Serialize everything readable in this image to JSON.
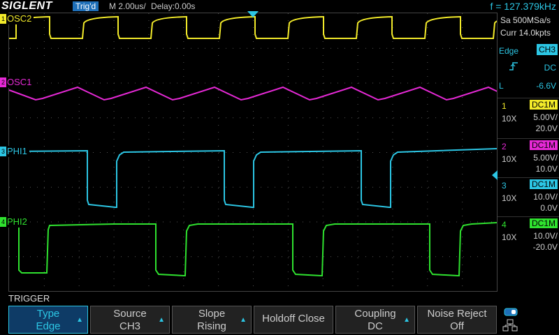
{
  "header": {
    "brand": "SIGLENT",
    "trigger_status": "Trig'd",
    "timebase": "M 2.00us/",
    "delay": "Delay:0.00s",
    "frequency": "f = 127.379kHz"
  },
  "channels": [
    {
      "num": "1",
      "label": "OSC2",
      "color": "#f2ea2a"
    },
    {
      "num": "2",
      "label": "OSC1",
      "color": "#e629d6"
    },
    {
      "num": "3",
      "label": "PHI1",
      "color": "#2cc6e4"
    },
    {
      "num": "4",
      "label": "PHI2",
      "color": "#2fe22f"
    }
  ],
  "acquisition": {
    "sample_rate": "Sa 500MSa/s",
    "memory": "Curr 14.0kpts"
  },
  "trigger_info": {
    "type": "Edge",
    "source": "CH3",
    "coupling": "DC",
    "level_label": "L",
    "level": "-6.6V"
  },
  "channel_settings": [
    {
      "num": "1",
      "coupling": "DC1M",
      "probe": "10X",
      "vdiv": "5.00V/",
      "offset": "20.0V",
      "color": "#f2ea2a"
    },
    {
      "num": "2",
      "coupling": "DC1M",
      "probe": "10X",
      "vdiv": "5.00V/",
      "offset": "10.0V",
      "color": "#e629d6"
    },
    {
      "num": "3",
      "coupling": "DC1M",
      "probe": "10X",
      "vdiv": "10.0V/",
      "offset": "0.0V",
      "color": "#2cc6e4"
    },
    {
      "num": "4",
      "coupling": "DC1M",
      "probe": "10X",
      "vdiv": "10.0V/",
      "offset": "-20.0V",
      "color": "#2fe22f"
    }
  ],
  "menu": {
    "title": "TRIGGER",
    "softkeys": [
      {
        "line1": "Type",
        "line2": "Edge"
      },
      {
        "line1": "Source",
        "line2": "CH3"
      },
      {
        "line1": "Slope",
        "line2": "Rising"
      },
      {
        "line1": "Holdoff Close",
        "line2": ""
      },
      {
        "line1": "Coupling",
        "line2": "DC"
      },
      {
        "line1": "Noise Reject",
        "line2": "Off"
      }
    ]
  }
}
